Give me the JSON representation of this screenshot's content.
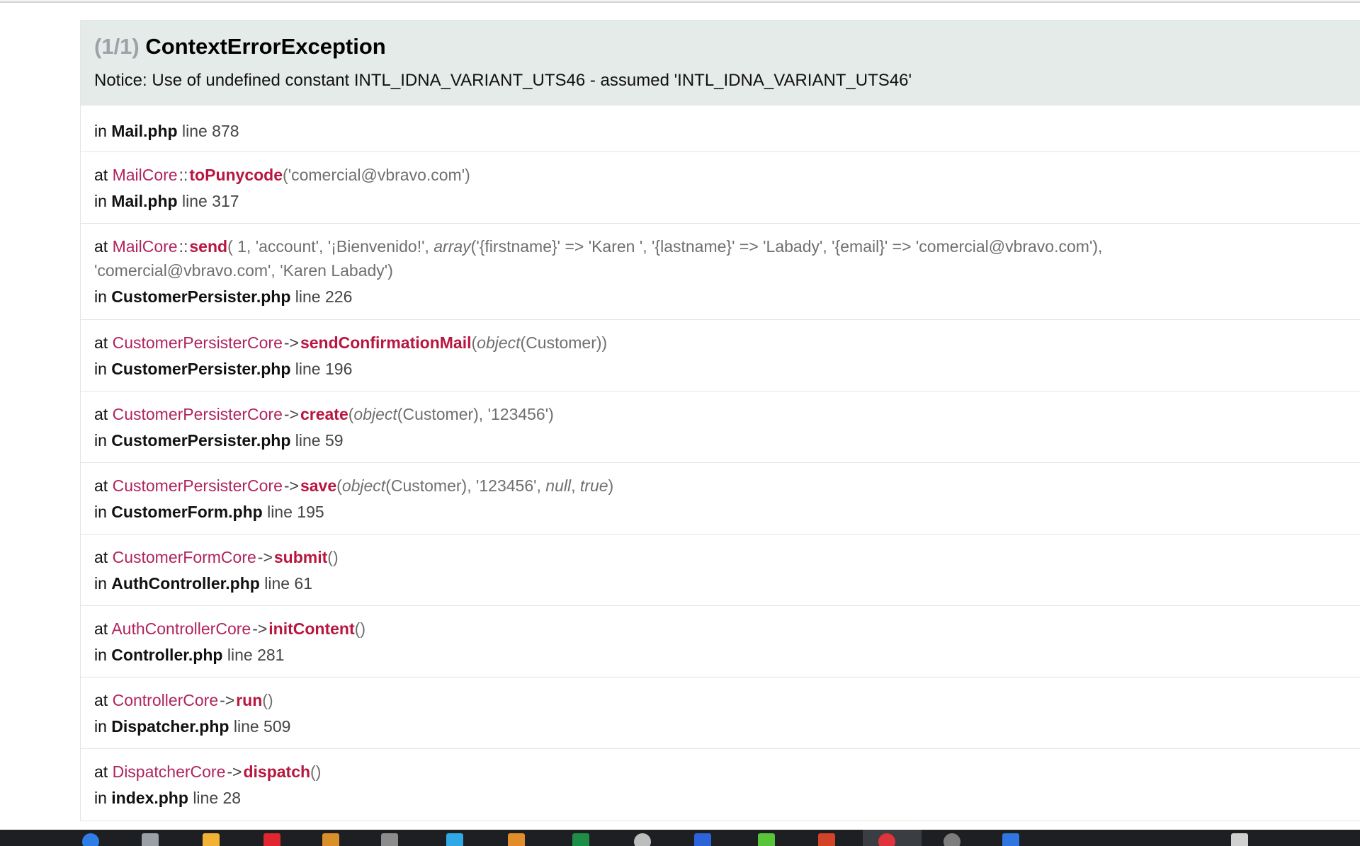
{
  "header": {
    "count": "(1/1)",
    "title": "ContextErrorException",
    "message": "Notice: Use of undefined constant INTL_IDNA_VARIANT_UTS46 - assumed 'INTL_IDNA_VARIANT_UTS46'"
  },
  "labels": {
    "in": "in",
    "at": "at",
    "line": "line",
    "static_sep": "::",
    "instance_sep": "->",
    "open": "(",
    "close": ")"
  },
  "trace": [
    {
      "file": "Mail.php",
      "line": "878"
    },
    {
      "class": "MailCore",
      "sep": "::",
      "method": "toPunycode",
      "args": "'comercial@vbravo.com'",
      "file": "Mail.php",
      "line": "317"
    },
    {
      "class": "MailCore",
      "sep": "::",
      "method": "send",
      "args_part1": " 1, 'account', '¡Bienvenido!', ",
      "args_type": "array",
      "args_part2": "('{firstname}' => 'Karen ', '{lastname}' => 'Labady', '{email}' => 'comercial@vbravo.com'),",
      "args_part3": "'comercial@vbravo.com', 'Karen Labady'",
      "file": "CustomerPersister.php",
      "line": "226"
    },
    {
      "class": "CustomerPersisterCore",
      "sep": "->",
      "method": "sendConfirmationMail",
      "args_type": "object",
      "args_part2": "(Customer)",
      "file": "CustomerPersister.php",
      "line": "196"
    },
    {
      "class": "CustomerPersisterCore",
      "sep": "->",
      "method": "create",
      "args_type": "object",
      "args_part2": "(Customer), '123456'",
      "file": "CustomerPersister.php",
      "line": "59"
    },
    {
      "class": "CustomerPersisterCore",
      "sep": "->",
      "method": "save",
      "args_type": "object",
      "args_part2": "(Customer), '123456', ",
      "kw1": "null",
      "comma": ", ",
      "kw2": "true",
      "file": "CustomerForm.php",
      "line": "195"
    },
    {
      "class": "CustomerFormCore",
      "sep": "->",
      "method": "submit",
      "file": "AuthController.php",
      "line": "61"
    },
    {
      "class": "AuthControllerCore",
      "sep": "->",
      "method": "initContent",
      "file": "Controller.php",
      "line": "281"
    },
    {
      "class": "ControllerCore",
      "sep": "->",
      "method": "run",
      "file": "Dispatcher.php",
      "line": "509"
    },
    {
      "class": "DispatcherCore",
      "sep": "->",
      "method": "dispatch",
      "file": "index.php",
      "line": "28"
    }
  ],
  "taskbar": {
    "icons": [
      {
        "name": "browser-icon",
        "color": "#2f7ee8"
      },
      {
        "name": "search-icon",
        "color": "#9aa0a6"
      },
      {
        "name": "folder-icon",
        "color": "#f2b233"
      },
      {
        "name": "office-icon",
        "color": "#e0262e"
      },
      {
        "name": "app-icon",
        "color": "#d9902a"
      },
      {
        "name": "pen-icon",
        "color": "#8c8c8c"
      },
      {
        "name": "window-icon",
        "color": "#31a8e6"
      },
      {
        "name": "paint-icon",
        "color": "#e38d2a"
      },
      {
        "name": "excel-icon",
        "color": "#1e8e46"
      },
      {
        "name": "disc-icon",
        "color": "#bdbdbd"
      },
      {
        "name": "word-icon",
        "color": "#2b63d9"
      },
      {
        "name": "green-app-icon",
        "color": "#58c43a"
      },
      {
        "name": "powerpoint-icon",
        "color": "#d2432a"
      },
      {
        "name": "active-app-icon",
        "color": "#e0333c"
      },
      {
        "name": "settings-icon",
        "color": "#7d7d7d"
      },
      {
        "name": "blue-app-icon",
        "color": "#2f76e0"
      },
      {
        "name": "tray-icon",
        "color": "#d0d0d0"
      }
    ]
  }
}
